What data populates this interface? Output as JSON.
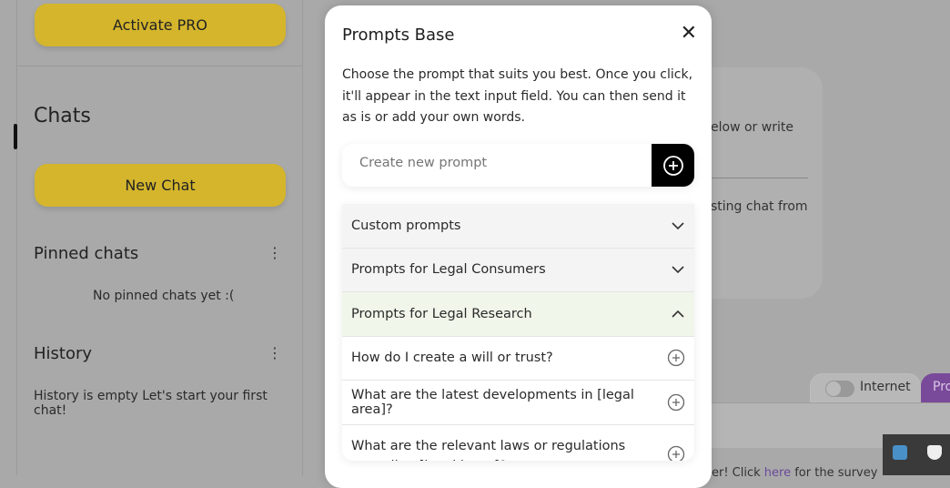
{
  "sidebar": {
    "activate_pro": "Activate PRO",
    "chats_title": "Chats",
    "new_chat": "New Chat",
    "pinned_title": "Pinned chats",
    "pinned_empty": "No pinned chats yet :(",
    "history_title": "History",
    "history_empty": "History is empty Let's start your first chat!"
  },
  "background": {
    "card_line1": "elow or write",
    "card_line2": "sting chat from",
    "internet_label": "Internet",
    "pro_tab": "Pro",
    "survey_prefix": "er! Click ",
    "survey_link": "here",
    "survey_suffix": " for the survey"
  },
  "modal": {
    "title": "Prompts Base",
    "description": "Choose the prompt that suits you best. Once you click, it'll appear in the text input field. You can then send it as is or add your own words.",
    "create_placeholder": "Create new prompt",
    "categories": [
      {
        "label": "Custom prompts",
        "expanded": false
      },
      {
        "label": "Prompts for Legal Consumers",
        "expanded": false
      },
      {
        "label": "Prompts for Legal Research",
        "expanded": true
      }
    ],
    "prompts": [
      "How do I create a will or trust?",
      "What are the latest developments in [legal area]?",
      "What are the relevant laws or regulations regarding [legal issue]?"
    ]
  },
  "colors": {
    "accent_yellow": "#d4b52c",
    "pro_purple": "#7a4a9a",
    "expanded_bg": "#f0f6ea"
  }
}
